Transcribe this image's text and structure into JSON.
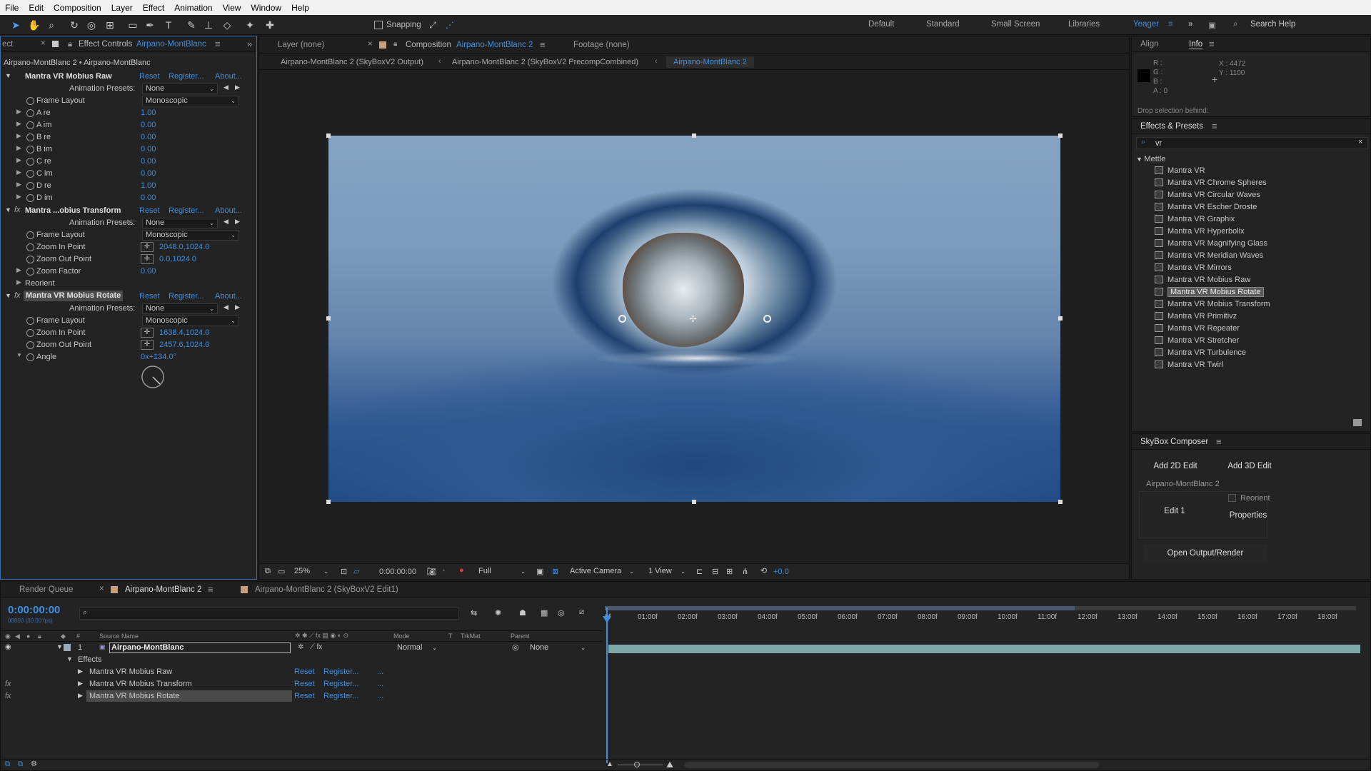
{
  "menu": [
    "File",
    "Edit",
    "Composition",
    "Layer",
    "Effect",
    "Animation",
    "View",
    "Window",
    "Help"
  ],
  "toolbar": {
    "snapping": "Snapping",
    "workspaces": [
      "Default",
      "Standard",
      "Small Screen",
      "Libraries"
    ],
    "active_workspace": "Yeager",
    "search": "Search Help"
  },
  "effect_controls": {
    "tab_left": "ect",
    "tab_title": "Effect Controls",
    "tab_layer": "Airpano-MontBlanc",
    "breadcrumb": "Airpano-MontBlanc 2 • Airpano-MontBlanc",
    "reset": "Reset",
    "register": "Register...",
    "about": "About...",
    "animation_presets_label": "Animation Presets:",
    "animation_presets_value": "None",
    "frame_layout_label": "Frame Layout",
    "frame_layout_value": "Monoscopic",
    "fx1": {
      "name": "Mantra VR Mobius Raw",
      "params": [
        {
          "label": "A re",
          "value": "1.00"
        },
        {
          "label": "A im",
          "value": "0.00"
        },
        {
          "label": "B re",
          "value": "0.00"
        },
        {
          "label": "B im",
          "value": "0.00"
        },
        {
          "label": "C re",
          "value": "0.00"
        },
        {
          "label": "C im",
          "value": "0.00"
        },
        {
          "label": "D re",
          "value": "1.00"
        },
        {
          "label": "D im",
          "value": "0.00"
        }
      ]
    },
    "fx2": {
      "name": "Mantra ...obius Transform",
      "zoom_in_label": "Zoom In Point",
      "zoom_in_value": "2048.0,1024.0",
      "zoom_out_label": "Zoom Out Point",
      "zoom_out_value": "0.0,1024.0",
      "zoom_factor_label": "Zoom Factor",
      "zoom_factor_value": "0.00",
      "reorient_label": "Reorient"
    },
    "fx3": {
      "name": "Mantra VR Mobius Rotate",
      "zoom_in_label": "Zoom In Point",
      "zoom_in_value": "1638.4,1024.0",
      "zoom_out_label": "Zoom Out Point",
      "zoom_out_value": "2457.6,1024.0",
      "angle_label": "Angle",
      "angle_value": "0x+134.0°"
    }
  },
  "viewer": {
    "tabs": {
      "layer": "Layer (none)",
      "composition": "Composition",
      "composition_name": "Airpano-MontBlanc 2",
      "footage": "Footage (none)"
    },
    "breadcrumbs": [
      "Airpano-MontBlanc 2 (SkyBoxV2 Output)",
      "Airpano-MontBlanc 2 (SkyBoxV2 PrecompCombined)",
      "Airpano-MontBlanc 2"
    ],
    "bottom": {
      "zoom": "25%",
      "time": "0:00:00:00",
      "resolution": "Full",
      "camera": "Active Camera",
      "views": "1 View",
      "exposure": "+0.0"
    }
  },
  "info_panel": {
    "tabs": [
      "Align",
      "Info"
    ],
    "r": "R :",
    "g": "G :",
    "b": "B :",
    "a": "A : 0",
    "x": "X : 4472",
    "y": "Y : 1100",
    "drop_hint": "Drop selection behind:"
  },
  "effects_presets": {
    "title": "Effects & Presets",
    "search": "vr",
    "group": "Mettle",
    "selected": "Mantra VR Mobius Rotate",
    "items": [
      "Mantra VR",
      "Mantra VR Chrome Spheres",
      "Mantra VR Circular Waves",
      "Mantra VR Escher Droste",
      "Mantra VR Graphix",
      "Mantra VR Hyperbolix",
      "Mantra VR Magnifying Glass",
      "Mantra VR Meridian Waves",
      "Mantra VR Mirrors",
      "Mantra VR Mobius Raw",
      "Mantra VR Mobius Rotate",
      "Mantra VR Mobius Transform",
      "Mantra VR Primitivz",
      "Mantra VR Repeater",
      "Mantra VR Stretcher",
      "Mantra VR Turbulence",
      "Mantra VR Twirl"
    ]
  },
  "skybox": {
    "title": "SkyBox Composer",
    "add2d": "Add 2D Edit",
    "add3d": "Add 3D Edit",
    "comp": "Airpano-MontBlanc 2",
    "edit1": "Edit 1",
    "reorient": "Reorient",
    "properties": "Properties",
    "open_output": "Open Output/Render"
  },
  "timeline": {
    "tabs": {
      "render_queue": "Render Queue",
      "comp": "Airpano-MontBlanc 2",
      "comp2": "Airpano-MontBlanc 2 (SkyBoxV2 Edit1)"
    },
    "timecode": "0:00:00:00",
    "fps": "00000 (30.00 fps)",
    "headers": {
      "num": "#",
      "source": "Source Name",
      "mode": "Mode",
      "t": "T",
      "trkmat": "TrkMat",
      "parent": "Parent"
    },
    "layer": {
      "num": "1",
      "name": "Airpano-MontBlanc",
      "mode": "Normal",
      "parent": "None"
    },
    "effects_label": "Effects",
    "effects": [
      "Mantra VR Mobius Raw",
      "Mantra VR Mobius Transform",
      "Mantra VR Mobius Rotate"
    ],
    "reset": "Reset",
    "register": "Register...",
    "dots": "...",
    "ticks": [
      "0f",
      "01:00f",
      "02:00f",
      "03:00f",
      "04:00f",
      "05:00f",
      "06:00f",
      "07:00f",
      "08:00f",
      "09:00f",
      "10:00f",
      "11:00f",
      "12:00f",
      "13:00f",
      "14:00f",
      "15:00f",
      "16:00f",
      "17:00f",
      "18:00f"
    ]
  },
  "colors": {
    "accent": "#3d8fe0",
    "panel": "#232323",
    "dark": "#1c1c1c"
  }
}
